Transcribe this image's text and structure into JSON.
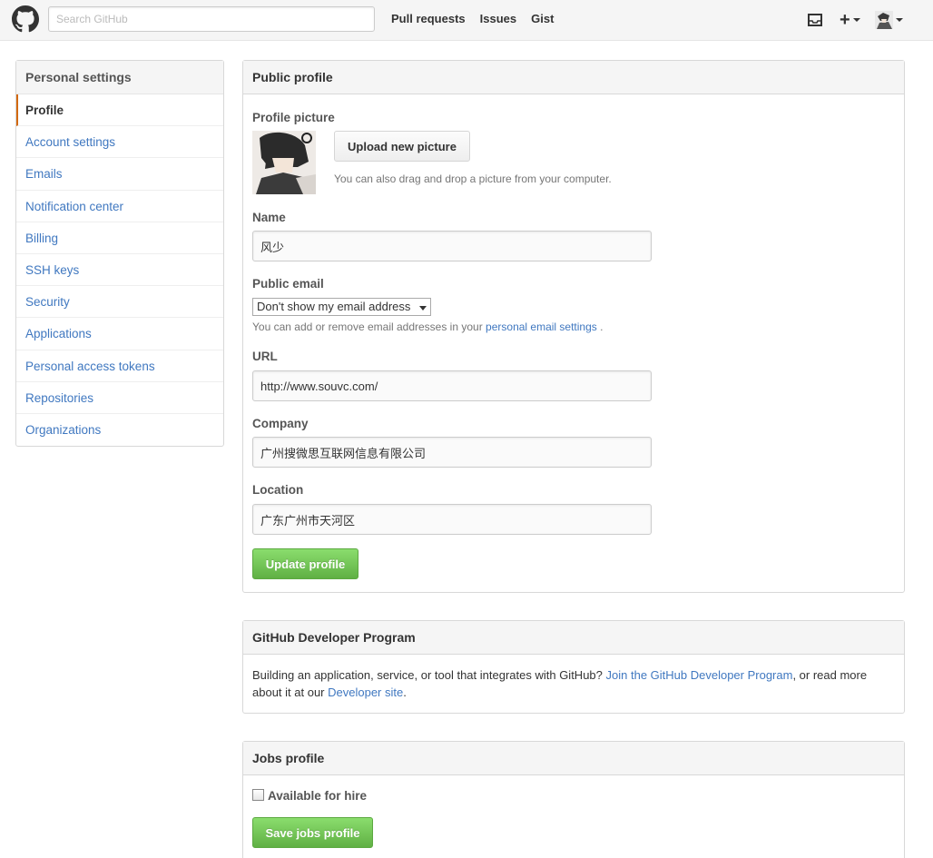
{
  "header": {
    "search_placeholder": "Search GitHub",
    "nav": [
      "Pull requests",
      "Issues",
      "Gist"
    ],
    "plus": "+"
  },
  "sidebar": {
    "heading": "Personal settings",
    "items": [
      {
        "label": "Profile",
        "selected": true
      },
      {
        "label": "Account settings"
      },
      {
        "label": "Emails"
      },
      {
        "label": "Notification center"
      },
      {
        "label": "Billing"
      },
      {
        "label": "SSH keys"
      },
      {
        "label": "Security"
      },
      {
        "label": "Applications"
      },
      {
        "label": "Personal access tokens"
      },
      {
        "label": "Repositories"
      },
      {
        "label": "Organizations"
      }
    ]
  },
  "profile": {
    "title": "Public profile",
    "picture_label": "Profile picture",
    "upload_button": "Upload new picture",
    "upload_note": "You can also drag and drop a picture from your computer.",
    "name_label": "Name",
    "name_value": "风少",
    "email_label": "Public email",
    "email_select": "Don't show my email address",
    "email_note_prefix": "You can add or remove email addresses in your",
    "email_note_link": "personal email settings",
    "email_note_suffix": ".",
    "url_label": "URL",
    "url_value": "http://www.souvc.com/",
    "company_label": "Company",
    "company_value": "广州搜微思互联网信息有限公司",
    "location_label": "Location",
    "location_value": "广东广州市天河区",
    "update_button": "Update profile"
  },
  "developer": {
    "title": "GitHub Developer Program",
    "text1": "Building an application, service, or tool that integrates with GitHub?",
    "link1": "Join the GitHub Developer Program",
    "text2": ", or read more about it at our",
    "link2": "Developer site",
    "text3": "."
  },
  "jobs": {
    "title": "Jobs profile",
    "checkbox_label": "Available for hire",
    "checked": false,
    "save_button": "Save jobs profile"
  },
  "colors": {
    "link": "#4078c0",
    "primary_button": "#60b044",
    "selected_accent": "#d26911"
  }
}
